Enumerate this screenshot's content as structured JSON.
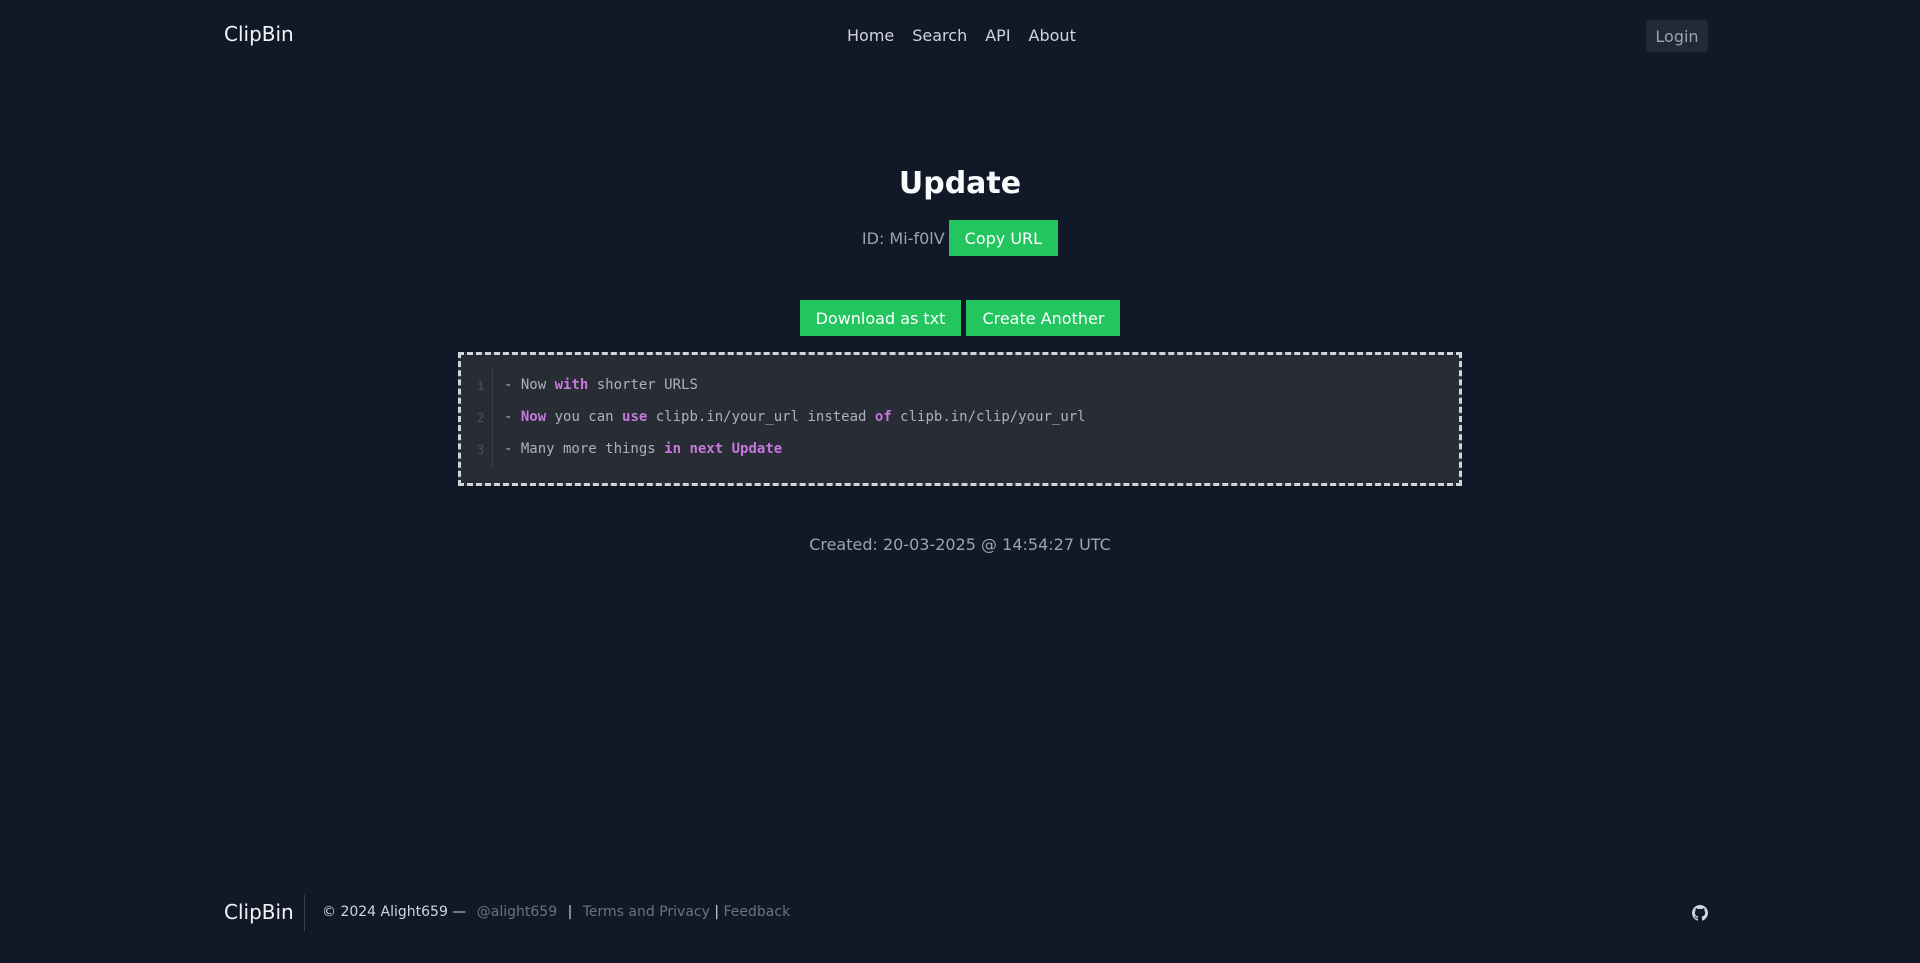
{
  "header": {
    "brand": "ClipBin",
    "nav": [
      "Home",
      "Search",
      "API",
      "About"
    ],
    "login": "Login"
  },
  "main": {
    "title": "Update",
    "id_label": "ID: Mi-f0lV",
    "copy_url": "Copy URL",
    "download": "Download as txt",
    "create_another": "Create Another",
    "code_lines": [
      {
        "num": "1",
        "parts": [
          [
            "- Now ",
            false
          ],
          [
            "with",
            true
          ],
          [
            " shorter URLS",
            false
          ]
        ]
      },
      {
        "num": "2",
        "parts": [
          [
            "- ",
            false
          ],
          [
            "Now",
            true
          ],
          [
            " you can ",
            false
          ],
          [
            "use",
            true
          ],
          [
            " clipb.in/your_url instead ",
            false
          ],
          [
            "of",
            true
          ],
          [
            " clipb.in/clip/your_url",
            false
          ]
        ]
      },
      {
        "num": "3",
        "parts": [
          [
            "- Many more things ",
            false
          ],
          [
            "in",
            true
          ],
          [
            " ",
            false
          ],
          [
            "next",
            true
          ],
          [
            " ",
            false
          ],
          [
            "Update",
            true
          ]
        ]
      }
    ],
    "created": "Created: 20-03-2025 @ 14:54:27 UTC"
  },
  "footer": {
    "brand": "ClipBin",
    "copyright": "© 2024 Alight659 —",
    "handle": "@alight659",
    "sep": "|",
    "terms": "Terms and Privacy",
    "sep2": "|",
    "feedback": "Feedback",
    "github_icon": "github-icon"
  },
  "colors": {
    "background": "#111827",
    "accent": "#22c55e",
    "keyword": "#c678dd"
  }
}
